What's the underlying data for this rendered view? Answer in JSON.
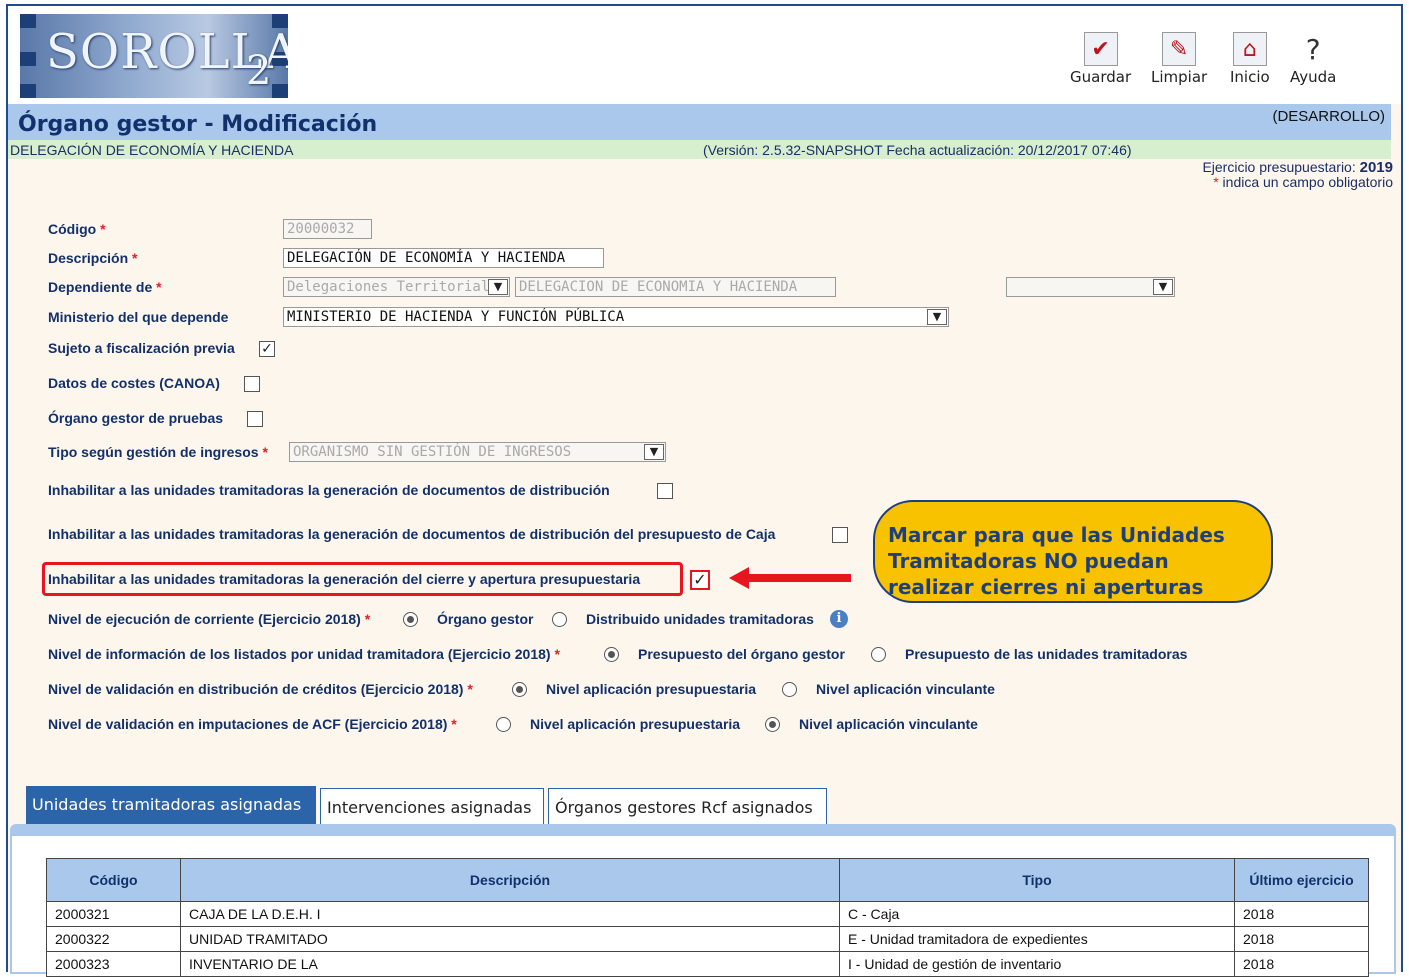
{
  "logo": {
    "text": "SOROLLA",
    "sub": "2"
  },
  "toolbar": [
    {
      "label": "Guardar",
      "icon": "save-icon"
    },
    {
      "label": "Limpiar",
      "icon": "eraser-icon"
    },
    {
      "label": "Inicio",
      "icon": "home-icon"
    },
    {
      "label": "Ayuda",
      "icon": "help-icon"
    }
  ],
  "header": {
    "title": "Órgano gestor - Modificación",
    "environment": "(DESARROLLO)",
    "organization": "DELEGACIÓN DE ECONOMÍA Y HACIENDA",
    "version": "(Versión: 2.5.32-SNAPSHOT Fecha actualización: 20/12/2017 07:46)",
    "ejercicio_label": "Ejercicio presupuestario:",
    "ejercicio_value": "2019",
    "required_note": "indica un campo obligatorio",
    "asterisk": "*"
  },
  "form": {
    "codigo_label": "Código",
    "codigo_value": "20000032",
    "descripcion_label": "Descripción",
    "descripcion_value": "DELEGACIÓN DE ECONOMÍA Y HACIENDA",
    "dependiente_label": "Dependiente de",
    "dependiente_tipo": "Delegaciones Territoriales",
    "dependiente_nombre": "DELEGACION DE ECONOMIA Y HACIENDA",
    "ministerio_label": "Ministerio del que depende",
    "ministerio_value": "MINISTERIO DE HACIENDA Y FUNCIÓN PÚBLICA",
    "fiscalizacion_label": "Sujeto a fiscalización previa",
    "fiscalizacion_checked": true,
    "canoa_label": "Datos de costes (CANOA)",
    "canoa_checked": false,
    "pruebas_label": "Órgano gestor de pruebas",
    "pruebas_checked": false,
    "tipo_ingresos_label": "Tipo según gestión de ingresos",
    "tipo_ingresos_value": "ORGANISMO SIN GESTIÓN DE INGRESOS",
    "inhab_docs_label": "Inhabilitar a las unidades tramitadoras la generación de documentos de distribución",
    "inhab_caja_label": "Inhabilitar a las unidades tramitadoras la generación de documentos de distribución del presupuesto de Caja",
    "inhab_cierre_label": "Inhabilitar a las unidades tramitadoras la generación del cierre y apertura presupuestaria",
    "inhab_cierre_checked": true,
    "nivel_ejec_label": "Nivel de ejecución de corriente (Ejercicio 2018)",
    "nivel_ejec_opt1": "Órgano gestor",
    "nivel_ejec_opt2": "Distribuido unidades tramitadoras",
    "nivel_info_label": "Nivel de información de los listados por unidad tramitadora (Ejercicio 2018)",
    "nivel_info_opt1": "Presupuesto del órgano gestor",
    "nivel_info_opt2": "Presupuesto de las unidades tramitadoras",
    "nivel_val_label": "Nivel de validación en distribución de créditos (Ejercicio 2018)",
    "nivel_val_opt1": "Nivel aplicación presupuestaria",
    "nivel_val_opt2": "Nivel aplicación vinculante",
    "nivel_acf_label": "Nivel de validación en imputaciones de ACF (Ejercicio 2018)",
    "nivel_acf_opt1": "Nivel aplicación presupuestaria",
    "nivel_acf_opt2": "Nivel aplicación vinculante"
  },
  "callout": "Marcar para que las Unidades Tramitadoras NO puedan realizar cierres ni aperturas",
  "colors": {
    "title_bar": "#a9c8ec",
    "callout": "#f9c200",
    "highlight": "#e8141e",
    "tab_active": "#2c64a9"
  },
  "tabs": [
    {
      "label": "Unidades tramitadoras asignadas",
      "active": true
    },
    {
      "label": "Intervenciones asignadas",
      "active": false
    },
    {
      "label": "Órganos gestores Rcf asignados",
      "active": false
    }
  ],
  "table": {
    "headers": [
      "Código",
      "Descripción",
      "Tipo",
      "Último ejercicio"
    ],
    "rows": [
      [
        "2000321",
        "CAJA DE LA D.E.H. I",
        "C - Caja",
        "2018"
      ],
      [
        "2000322",
        "UNIDAD TRAMITADO",
        "E - Unidad tramitadora de expedientes",
        "2018"
      ],
      [
        "2000323",
        "INVENTARIO DE LA",
        "I - Unidad de gestión de inventario",
        "2018"
      ]
    ]
  }
}
